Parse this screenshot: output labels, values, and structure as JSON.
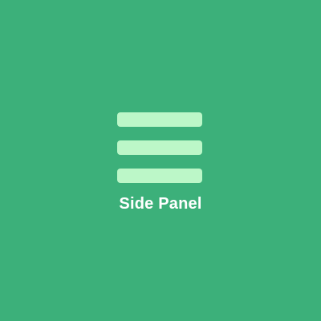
{
  "app": {
    "icon": "hamburger-menu-icon",
    "label": "Side Panel"
  },
  "colors": {
    "background": "#3cb07a",
    "icon": "#bcf7c8",
    "label": "#ffffff"
  }
}
